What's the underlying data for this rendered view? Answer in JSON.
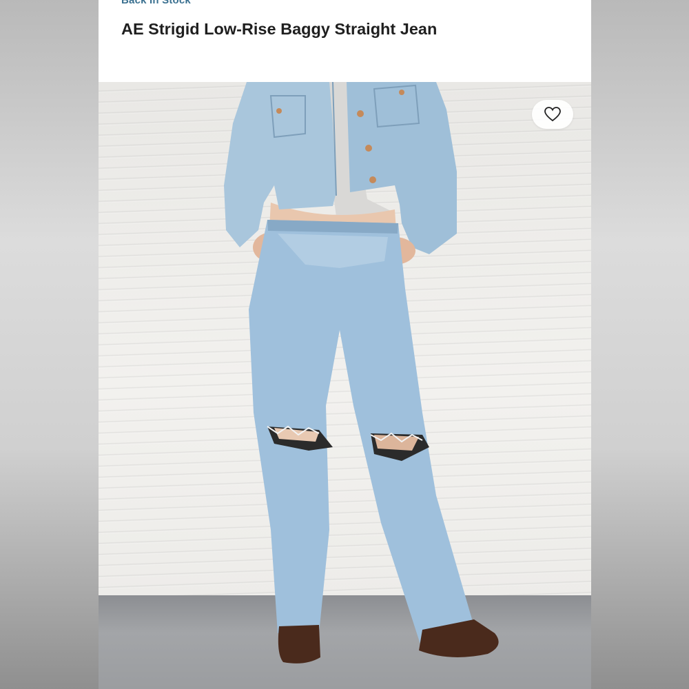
{
  "product": {
    "status_badge": "Back In Stock",
    "title": "AE Strigid Low-Rise Baggy Straight Jean"
  },
  "photo": {
    "alt": "Model wearing light-wash ripped baggy jeans with cropped denim jacket",
    "favorite_icon": "heart-icon"
  },
  "colors": {
    "badge": "#3a7090",
    "title": "#1f1f1f",
    "denim": "#9fc0dc",
    "jacket": "#a9c6dc",
    "shoes": "#4a2a1c"
  }
}
